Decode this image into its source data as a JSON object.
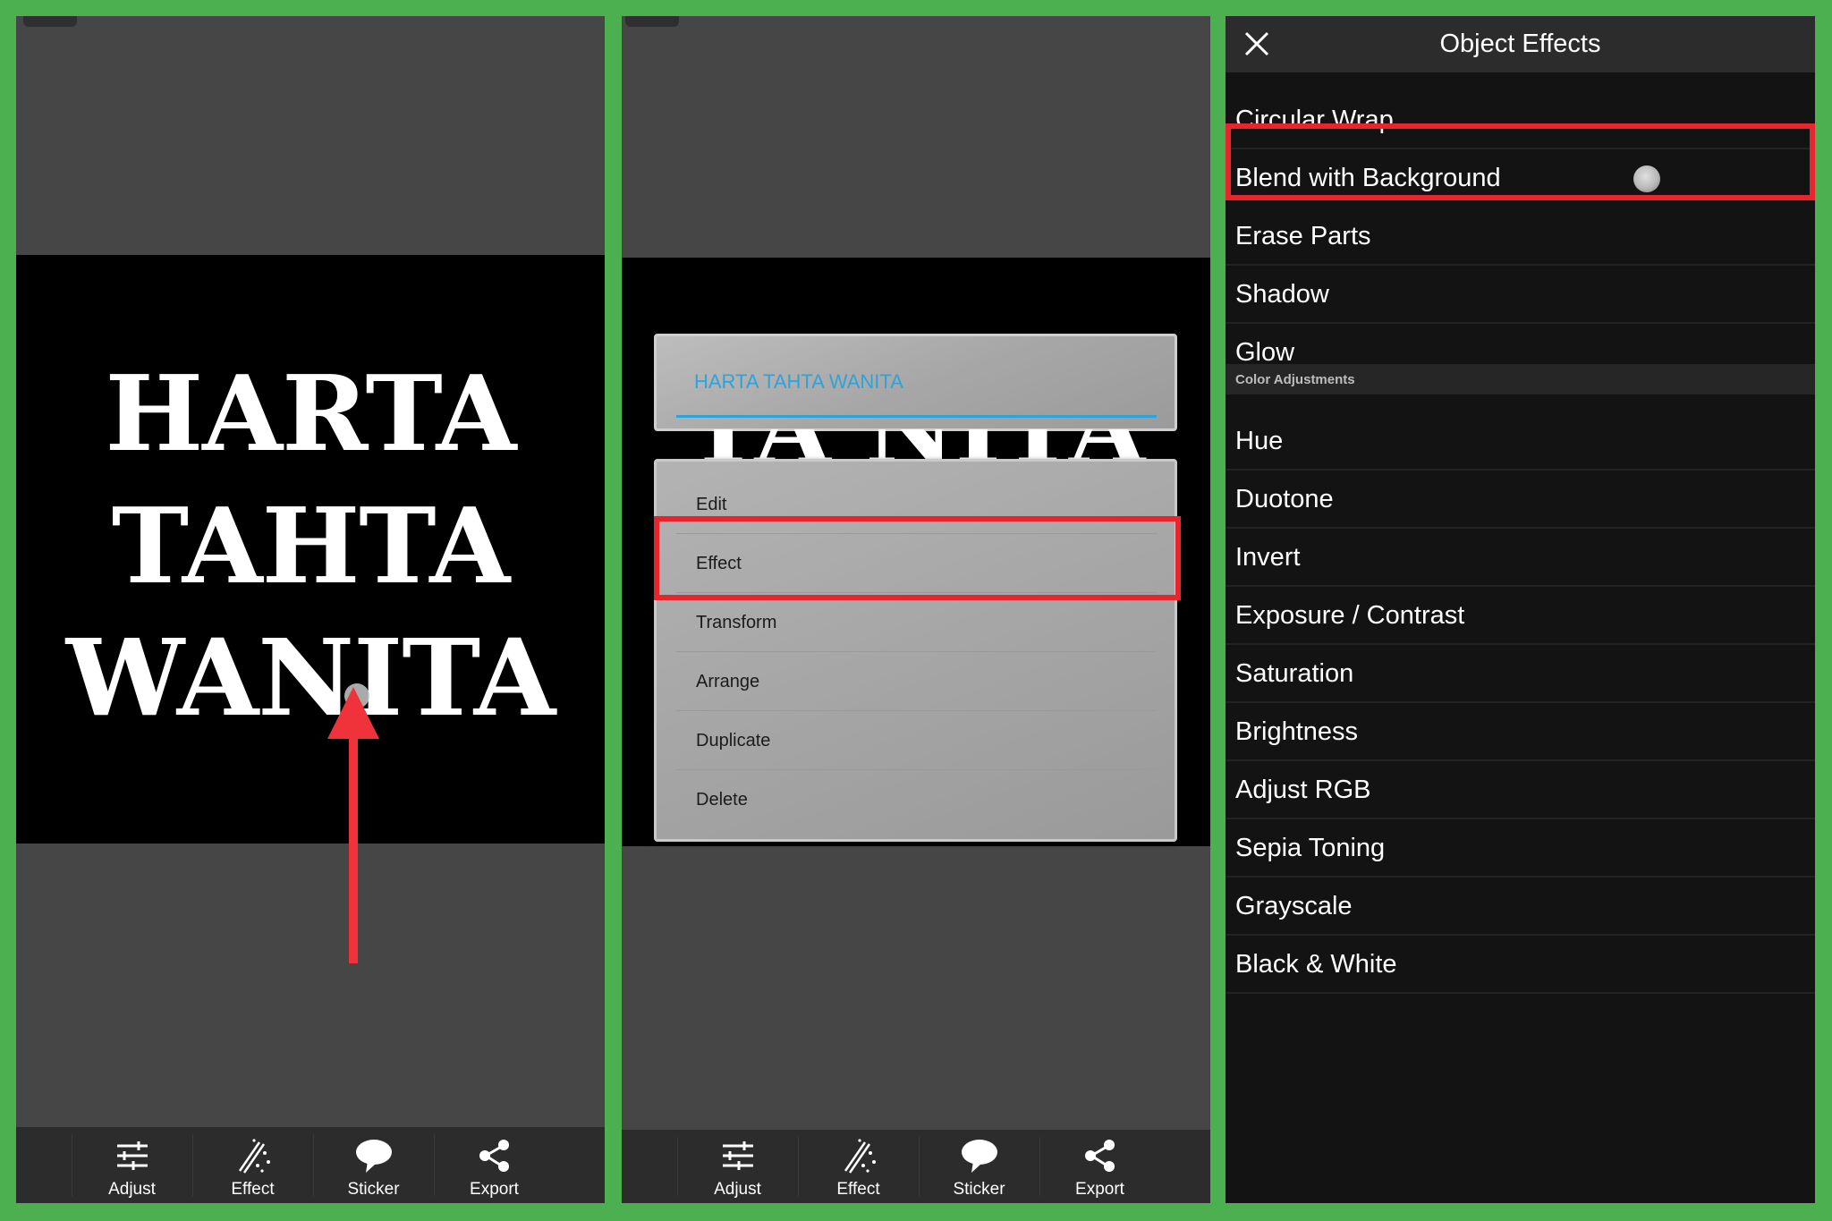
{
  "panel1": {
    "canvas_text": [
      "HARTA",
      "TAHTA",
      "WANITA"
    ]
  },
  "panel2": {
    "textbox_value": "HARTA TAHTA WANITA",
    "peek_text": "TA NITA",
    "menu_items": [
      "Edit",
      "Effect",
      "Transform",
      "Arrange",
      "Duplicate",
      "Delete"
    ],
    "highlighted_item": "Effect"
  },
  "toolbar": {
    "items": [
      {
        "label": "Adjust",
        "icon": "sliders-icon"
      },
      {
        "label": "Effect",
        "icon": "magic-wand-icon"
      },
      {
        "label": "Sticker",
        "icon": "speech-bubble-icon"
      },
      {
        "label": "Export",
        "icon": "share-icon"
      }
    ]
  },
  "panel3": {
    "title": "Object Effects",
    "effects": [
      "Circular Wrap",
      "Blend with Background",
      "Erase Parts",
      "Shadow",
      "Glow"
    ],
    "section_header": "Color Adjustments",
    "color_adjustments": [
      "Hue",
      "Duotone",
      "Invert",
      "Exposure / Contrast",
      "Saturation",
      "Brightness",
      "Adjust RGB",
      "Sepia Toning",
      "Grayscale",
      "Black & White"
    ],
    "highlighted_item": "Blend with Background"
  },
  "colors": {
    "frame_green": "#4caf50",
    "highlight_red": "#e8242d",
    "arrow_red": "#f0323a",
    "textbox_blue": "#2fa3d9"
  }
}
